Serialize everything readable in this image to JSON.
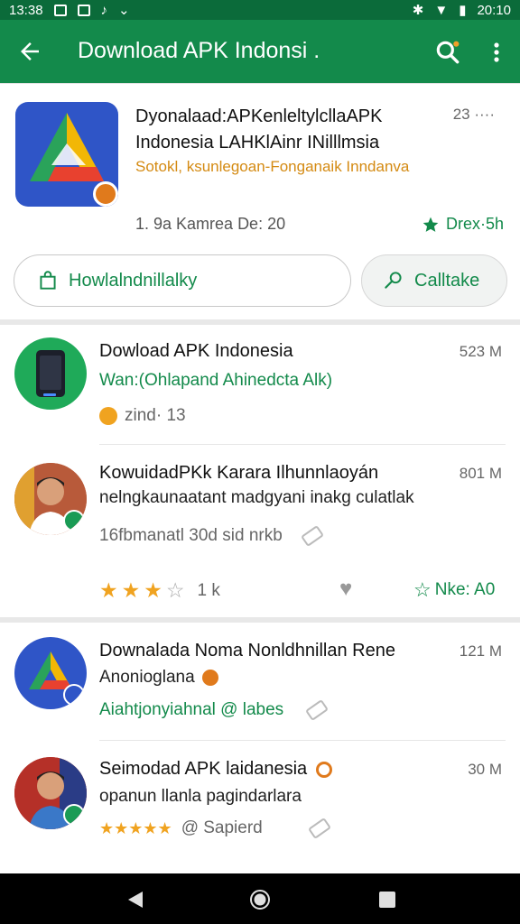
{
  "status_bar": {
    "time": "13:38",
    "right_time": "20:10",
    "colors": {
      "background": "#0b6b3a"
    }
  },
  "app_bar": {
    "title": "Download APK Indonsi .",
    "icons": [
      "back-arrow-icon",
      "search-icon",
      "more-vert-icon"
    ],
    "accent": "#138a4b"
  },
  "header": {
    "title": "Dyonalaad:APKenleltylcllaAPK Indonesia  LAHKlAinr INilllmsia",
    "subtitle": "Sotokl, ksunlegoan-Fonganaik Inndanva",
    "meta": "23 ····",
    "left_meta": "1. 9a Kamrea De: 20",
    "right_meta": "Drex·5h",
    "primary_button": "Howlalndnillalky",
    "secondary_button": "Calltake"
  },
  "list": [
    {
      "title": "Dowload APK Indonesia",
      "line1": "Wan:(Ohlapand Ahinedcta Alk)",
      "meta": "zind· 13",
      "size": "523 M"
    },
    {
      "title": "KowuidadPKk Karara Ilhunnlaoyán",
      "line1": "nelngkaunaatant madgyani inakg culatlak",
      "line2": "16fbmanatl  30d sid  nrkb",
      "rating_count": "1 k",
      "action": "Nke: A0",
      "size": "801 M"
    },
    {
      "title": "Downalada Noma Nonldhnillan Rene",
      "line1": "Anonioglana",
      "line2": "Aiahtjonyiahnal  @ labes",
      "size": "121 M"
    },
    {
      "title": "Seimodad APK laidanesia",
      "line1": "opanun llanla pagindarlara",
      "line2": "@ Sapierd",
      "size": "30 M"
    }
  ]
}
